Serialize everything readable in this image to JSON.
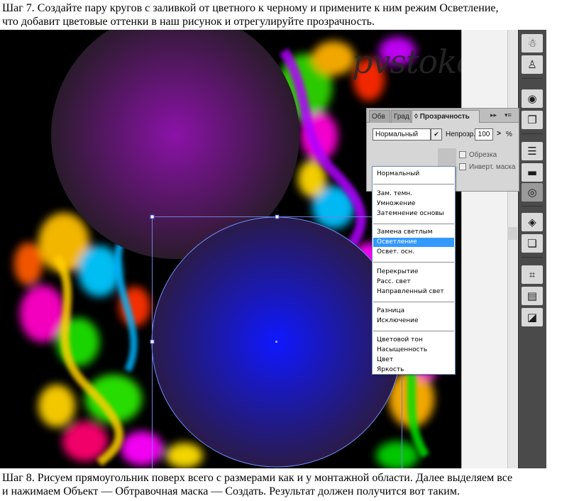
{
  "step7": {
    "line1": "Шаг 7. Создайте пару кругов с заливкой от цветного к черному и примените к ним режим Осветление,",
    "line2": "что добавит цветовые оттенки в наш рисунок и отрегулируйте прозрачность."
  },
  "step8": {
    "line1": "Шаг 8. Рисуем прямоугольник поверх всего с размерами как и у монтажной области. Далее выделяем все",
    "line2": "и нажимаем Объект — Обтравочная маска — Создать. Результат должен получится вот таким."
  },
  "watermark": "pvstoker.com",
  "colors": {
    "circle_purple": "#8b12a8",
    "circle_blue": "#0f18ff",
    "highlight": "#3399ff"
  },
  "panel": {
    "tabs": [
      "Обв",
      "Град",
      "◊ Прозрачность"
    ],
    "menu_icon": "▸▸",
    "blend_mode": "Нормальный",
    "opacity_label": "Непрозр.:",
    "opacity_value": "100",
    "opacity_arrow": ">",
    "percent": "%",
    "clip_label": "Обрезка",
    "invert_label": "Инверт. маска"
  },
  "blend_modes": [
    {
      "label": "Нормальный",
      "selected": false
    },
    {
      "label": "Зам. темн.",
      "selected": false
    },
    {
      "label": "Умножение",
      "selected": false
    },
    {
      "label": "Затемнение основы",
      "selected": false
    },
    {
      "label": "Замена светлым",
      "selected": false
    },
    {
      "label": "Осветление",
      "selected": true
    },
    {
      "label": "Освет. осн.",
      "selected": false
    },
    {
      "label": "Перекрытие",
      "selected": false
    },
    {
      "label": "Расс. свет",
      "selected": false
    },
    {
      "label": "Направленный свет",
      "selected": false
    },
    {
      "label": "Разница",
      "selected": false
    },
    {
      "label": "Исключение",
      "selected": false
    },
    {
      "label": "Цветовой тон",
      "selected": false
    },
    {
      "label": "Насыщенность",
      "selected": false
    },
    {
      "label": "Цвет",
      "selected": false
    },
    {
      "label": "Яркость",
      "selected": false
    }
  ],
  "toolbar_icons": [
    "symbol-sprayer-icon",
    "puppet-icon",
    "appearance-icon",
    "graphic-styles-icon",
    "stroke-icon",
    "gradient-icon",
    "transparency-icon",
    "layers-icon",
    "artboards-icon",
    "transform-icon",
    "align-icon",
    "pathfinder-icon"
  ]
}
